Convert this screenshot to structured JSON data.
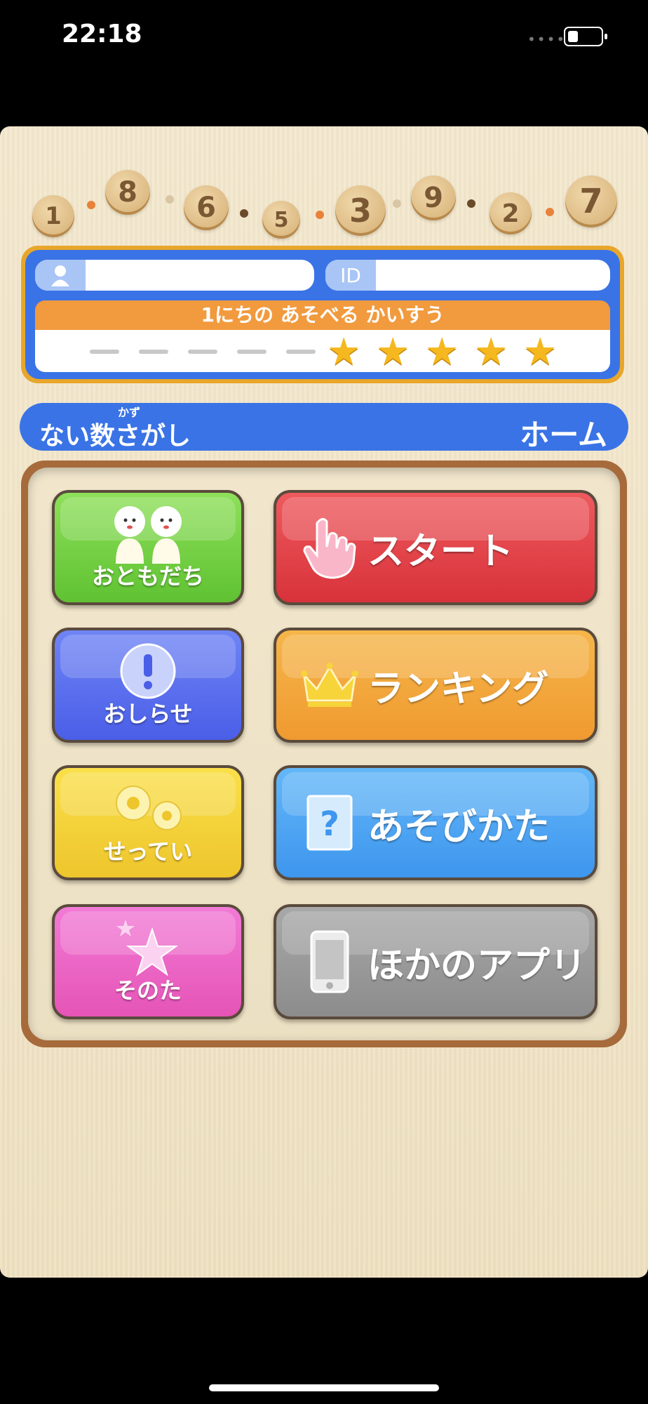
{
  "status_bar": {
    "time": "22:18",
    "signal": "••••"
  },
  "digits": [
    "1",
    "8",
    "6",
    "5",
    "3",
    "9",
    "2",
    "7"
  ],
  "user_panel": {
    "user_tag_icon": "person-icon",
    "user_value": "",
    "id_tag": "ID",
    "id_value": "",
    "plays_title": "1にちの あそべる かいすう",
    "used_count": 5,
    "remaining_count": 5,
    "star_glyph": "★"
  },
  "title_bar": {
    "ruby": "かず",
    "game_name": "ない数さがし",
    "screen_name": "ホーム"
  },
  "menu": {
    "friends": "おともだち",
    "start": "スタート",
    "news": "おしらせ",
    "ranking": "ランキング",
    "settings": "せってい",
    "howto": "あそびかた",
    "other": "そのた",
    "other_apps": "ほかのアプリ"
  },
  "colors": {
    "blue": "#3a73e6",
    "orange_panel": "#f19a3e",
    "green": "#7fd84a",
    "red": "#e0404a",
    "purple": "#5a6ef0",
    "orange": "#f3a53a",
    "yellow": "#f3d63a",
    "sky": "#4ea6f2",
    "pink": "#ec66c6",
    "gray": "#9a9a9a"
  }
}
